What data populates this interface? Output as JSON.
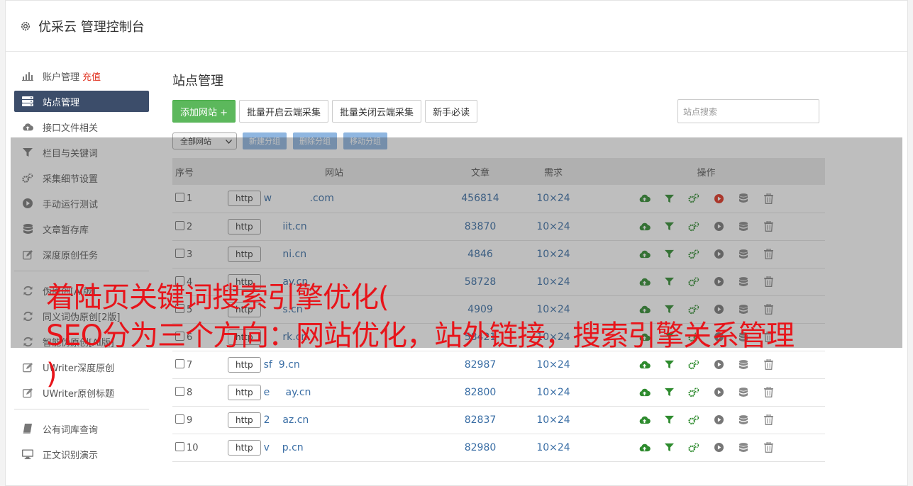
{
  "header": {
    "title": "优采云 管理控制台"
  },
  "sidebar": {
    "items": [
      {
        "label": "账户管理",
        "extra": "充值",
        "icon": "bar-chart-icon"
      },
      {
        "label": "站点管理",
        "icon": "server-icon",
        "active": true
      },
      {
        "label": "接口文件相关",
        "icon": "cloud-upload-icon"
      },
      {
        "label": "栏目与关键词",
        "icon": "filter-icon"
      },
      {
        "label": "采集细节设置",
        "icon": "gears-icon"
      },
      {
        "label": "手动运行测试",
        "icon": "play-circle-icon"
      },
      {
        "label": "文章暂存库",
        "icon": "database-icon"
      },
      {
        "label": "深度原创任务",
        "icon": "edit-icon"
      }
    ],
    "items2": [
      {
        "label": "伪原创[AI版]",
        "icon": "refresh-icon"
      },
      {
        "label": "同义词伪原创[2版]",
        "icon": "refresh-icon"
      },
      {
        "label": "智能伪原创[AI版]",
        "icon": "refresh-icon"
      },
      {
        "label": "UWriter深度原创",
        "icon": "edit-icon"
      },
      {
        "label": "UWriter原创标题",
        "icon": "edit-icon"
      }
    ],
    "items3": [
      {
        "label": "公有词库查询",
        "icon": "book-icon"
      },
      {
        "label": "正文识别演示",
        "icon": "monitor-icon"
      }
    ]
  },
  "main": {
    "title": "站点管理",
    "add_site": "添加网站 +",
    "batch_open": "批量开启云端采集",
    "batch_close": "批量关闭云端采集",
    "newbie": "新手必读",
    "search_placeholder": "站点搜索",
    "group_select": "全部网站",
    "new_group": "新建分组",
    "delete_group": "删除分组",
    "move_group": "移动分组"
  },
  "table": {
    "headers": {
      "seq": "序号",
      "site": "网站",
      "articles": "文章",
      "demand": "需求",
      "ops": "操作"
    },
    "rows": [
      {
        "seq": "1",
        "scheme": "http",
        "site": "w            .com",
        "articles": "456814",
        "demand": "10×24",
        "running": true
      },
      {
        "seq": "2",
        "scheme": "http",
        "site": "      iit.cn",
        "articles": "83870",
        "demand": "10×24"
      },
      {
        "seq": "3",
        "scheme": "http",
        "site": "      ni.cn",
        "articles": "4846",
        "demand": "10×24"
      },
      {
        "seq": "4",
        "scheme": "http",
        "site": "      ay.cn",
        "articles": "58728",
        "demand": "10×24"
      },
      {
        "seq": "5",
        "scheme": "http",
        "site": "      s.cn",
        "articles": "4909",
        "demand": "10×24"
      },
      {
        "seq": "6",
        "scheme": "http",
        "site": "      rk.cn",
        "articles": "58421",
        "demand": "10×24"
      },
      {
        "seq": "7",
        "scheme": "http",
        "site": "sf  9.cn",
        "articles": "82987",
        "demand": "10×24"
      },
      {
        "seq": "8",
        "scheme": "http",
        "site": "e     ay.cn",
        "articles": "82800",
        "demand": "10×24"
      },
      {
        "seq": "9",
        "scheme": "http",
        "site": "2    az.cn",
        "articles": "82837",
        "demand": "10×24"
      },
      {
        "seq": "10",
        "scheme": "http",
        "site": "v    p.cn",
        "articles": "82980",
        "demand": "10×24"
      }
    ]
  },
  "caption": {
    "line1": "着陆页关键词搜索引擎优化(",
    "line2": "SEO分为三个方向：网站优化，站外链接，搜索引擎关系管理",
    "line3": ")"
  },
  "colors": {
    "active_nav": "#3c4d6a",
    "green": "#5cb85c",
    "link": "#3a6ea5",
    "caption": "#e8141a"
  }
}
